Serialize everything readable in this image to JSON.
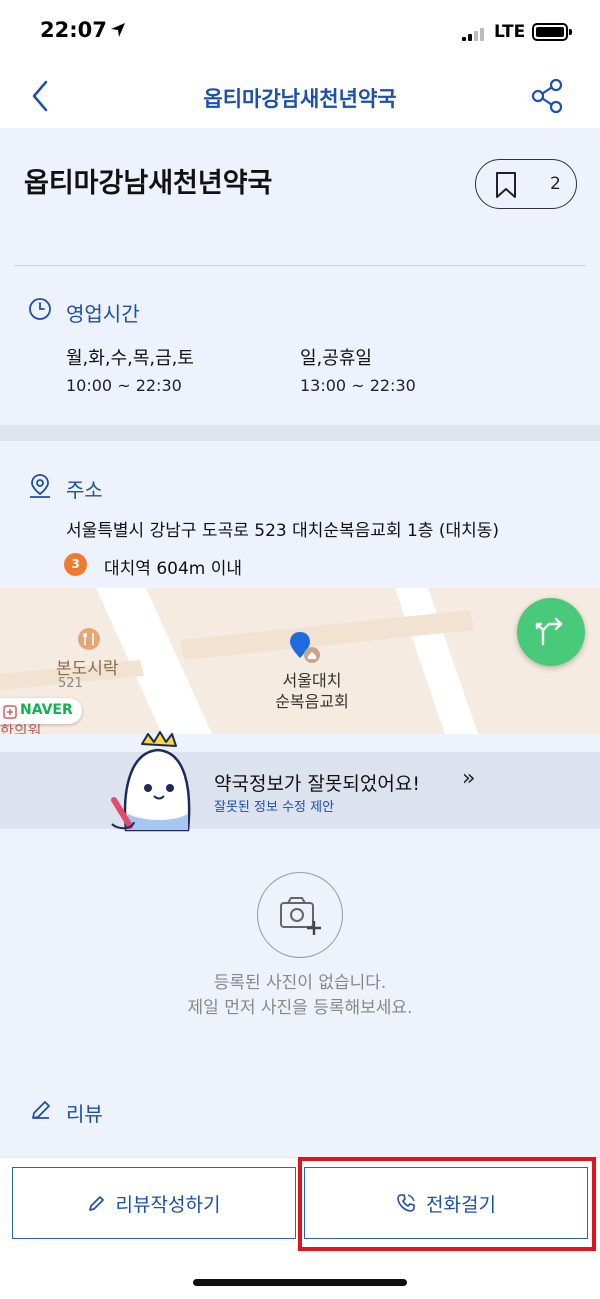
{
  "status_bar": {
    "time": "22:07",
    "network": "LTE"
  },
  "navbar": {
    "title": "옵티마강남새천년약국"
  },
  "place": {
    "name": "옵티마강남새천년약국",
    "bookmark_count": "2"
  },
  "hours": {
    "title": "영업시간",
    "entries": [
      {
        "days": "월,화,수,목,금,토",
        "time": "10:00 ~ 22:30"
      },
      {
        "days": "일,공휴일",
        "time": "13:00 ~ 22:30"
      }
    ]
  },
  "address": {
    "title": "주소",
    "text": "서울특별시 강남구 도곡로 523 대치순복음교회 1층 (대치동)",
    "subway_line": "3",
    "subway_text": "대치역 604m 이내"
  },
  "map": {
    "poi_restaurant": "본도시락",
    "poi_restaurant_number": "521",
    "poi_church_line1": "서울대치",
    "poi_church_line2": "순복음교회",
    "poi_partial": "한의원",
    "provider": "NAVER"
  },
  "banner": {
    "title": "약국정보가 잘못되었어요!",
    "subtitle": "잘못된 정보 수정 제안",
    "arrow": "»"
  },
  "photos": {
    "empty_line1": "등록된 사진이 없습니다.",
    "empty_line2": "제일 먼저 사진을 등록해보세요."
  },
  "review": {
    "title": "리뷰"
  },
  "actions": {
    "write_review": "리뷰작성하기",
    "call": "전화걸기"
  },
  "colors": {
    "accent": "#1b4fb0",
    "route_button": "#49ca7a",
    "subway_line3": "#ee7b30",
    "highlight": "#e0141e"
  }
}
